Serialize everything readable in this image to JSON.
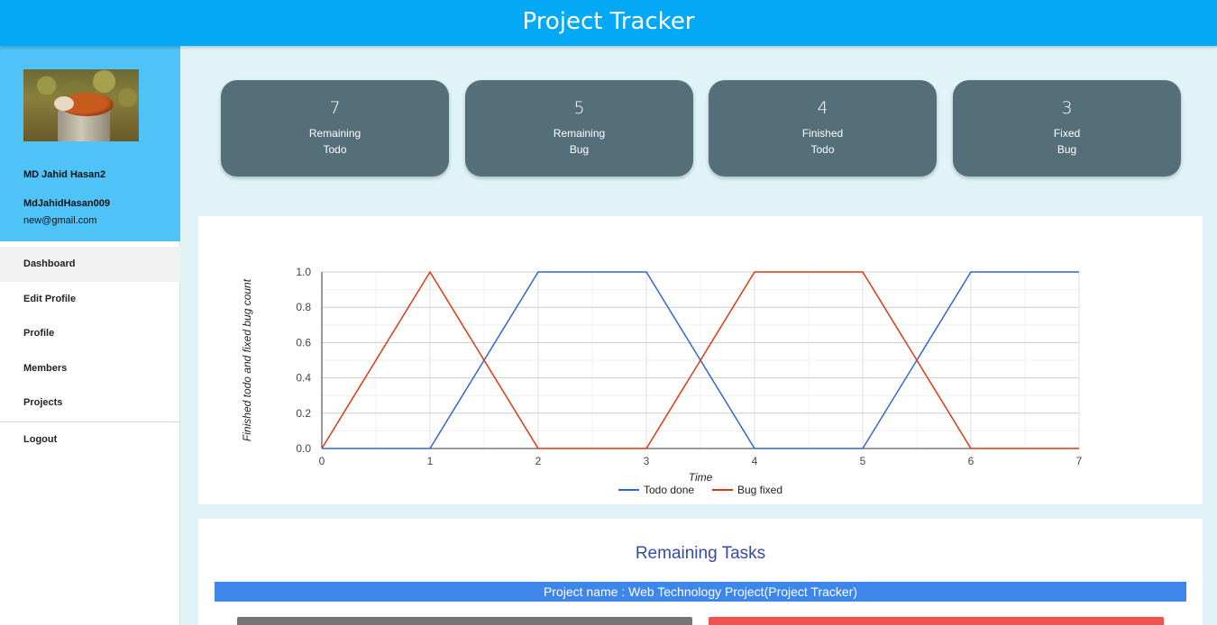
{
  "app": {
    "title": "Project Tracker"
  },
  "user": {
    "name": "MD Jahid Hasan2",
    "handle": "MdJahidHasan009",
    "email": "new@gmail.com"
  },
  "nav": {
    "items": [
      {
        "label": "Dashboard",
        "active": true
      },
      {
        "label": "Edit Profile"
      },
      {
        "label": "Profile"
      },
      {
        "label": "Members"
      },
      {
        "label": "Projects"
      }
    ],
    "logout": "Logout"
  },
  "stats": [
    {
      "value": "7",
      "line1": "Remaining",
      "line2": "Todo"
    },
    {
      "value": "5",
      "line1": "Remaining",
      "line2": "Bug"
    },
    {
      "value": "4",
      "line1": "Finished",
      "line2": "Todo"
    },
    {
      "value": "3",
      "line1": "Fixed",
      "line2": "Bug"
    }
  ],
  "chart_data": {
    "type": "line",
    "xlabel": "Time",
    "ylabel": "Finished todo and fixed bug count",
    "xlim": [
      0,
      7
    ],
    "ylim": [
      0,
      1
    ],
    "x_ticks": [
      "0",
      "1",
      "2",
      "3",
      "4",
      "5",
      "6",
      "7"
    ],
    "y_ticks": [
      "0.0",
      "0.2",
      "0.4",
      "0.6",
      "0.8",
      "1.0"
    ],
    "x": [
      0,
      1,
      2,
      3,
      4,
      5,
      6,
      7
    ],
    "series": [
      {
        "name": "Todo done",
        "color": "#3366cc",
        "values": [
          0,
          0,
          1,
          1,
          0,
          0,
          1,
          1
        ]
      },
      {
        "name": "Bug fixed",
        "color": "#dc3912",
        "values": [
          0,
          1,
          0,
          0,
          1,
          1,
          0,
          0
        ]
      }
    ],
    "grid": true,
    "legend": "bottom"
  },
  "tasks": {
    "title": "Remaining Tasks",
    "project_label": "Project name : Web Technology Project(Project Tracker)"
  },
  "colors": {
    "topbar": "#03a9f4",
    "profile_bg": "#4fc3f7",
    "card_bg": "#546e7a",
    "project_bar": "#3f86ea",
    "tasks_title": "#3949ab"
  }
}
